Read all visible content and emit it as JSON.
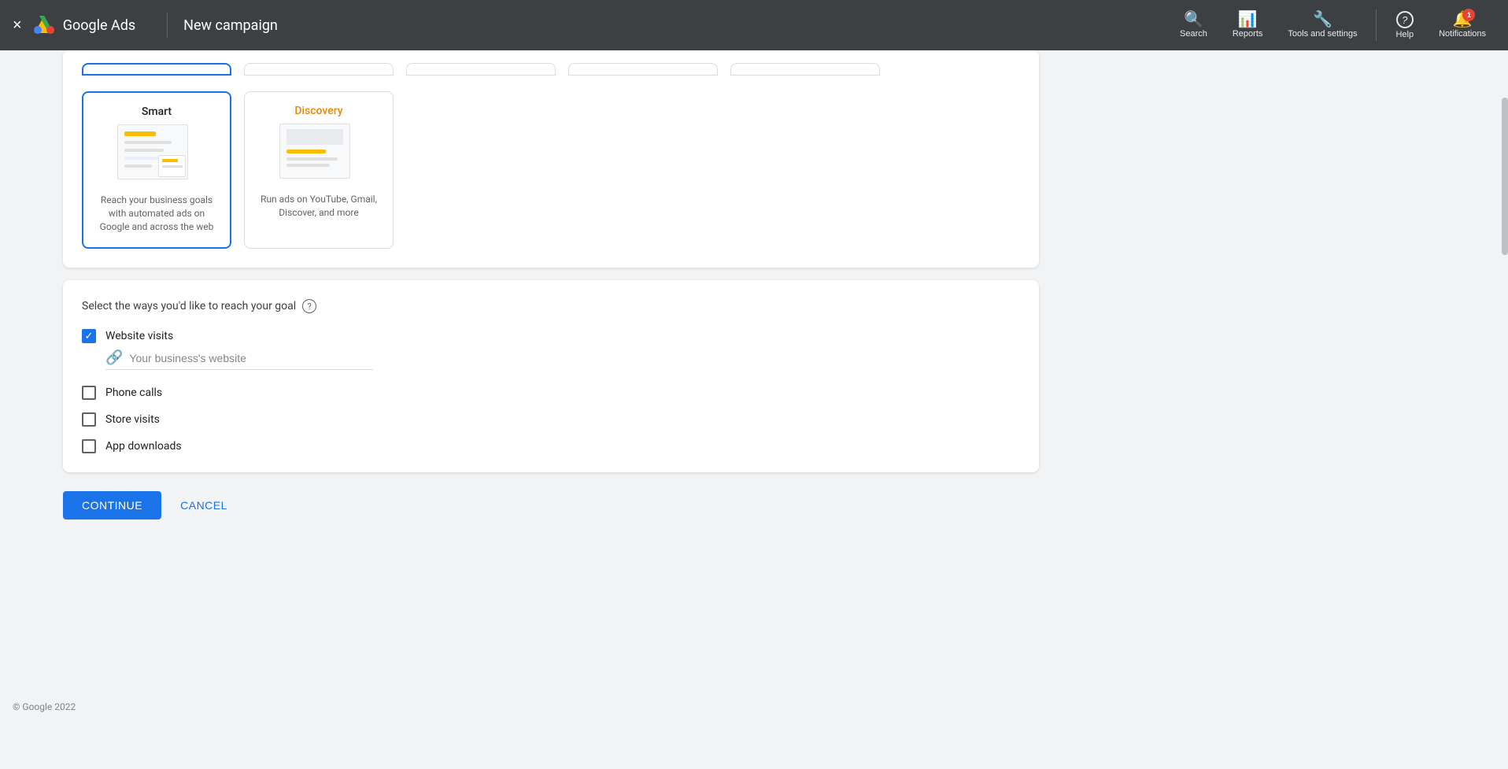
{
  "topnav": {
    "close_label": "×",
    "brand": "Google Ads",
    "title": "New campaign",
    "actions": [
      {
        "id": "search",
        "label": "Search",
        "icon": "🔍"
      },
      {
        "id": "reports",
        "label": "Reports",
        "icon": "📊"
      },
      {
        "id": "tools",
        "label": "Tools and settings",
        "icon": "🔧"
      },
      {
        "id": "help",
        "label": "Help",
        "icon": "?"
      },
      {
        "id": "notifications",
        "label": "Notifications",
        "icon": "🔔",
        "badge": "1"
      }
    ]
  },
  "campaign_types": {
    "cards": [
      {
        "id": "smart",
        "title": "Smart",
        "desc": "Reach your business goals with automated ads on Google and across the web",
        "selected": true,
        "title_color": "default"
      },
      {
        "id": "discovery",
        "title": "Discovery",
        "desc": "Run ads on YouTube, Gmail, Discover, and more",
        "selected": false,
        "title_color": "discovery"
      }
    ]
  },
  "goal_section": {
    "header": "Select the ways you'd like to reach your goal",
    "help_tooltip": "?",
    "checkboxes": [
      {
        "id": "website-visits",
        "label": "Website visits",
        "checked": true
      },
      {
        "id": "phone-calls",
        "label": "Phone calls",
        "checked": false
      },
      {
        "id": "store-visits",
        "label": "Store visits",
        "checked": false
      },
      {
        "id": "app-downloads",
        "label": "App downloads",
        "checked": false
      }
    ],
    "website_placeholder": "Your business's website"
  },
  "actions": {
    "continue_label": "CONTINUE",
    "cancel_label": "CANCEL"
  },
  "footer": {
    "text": "© Google 2022"
  }
}
